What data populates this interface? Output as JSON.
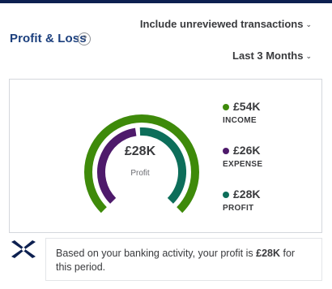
{
  "header": {
    "title": "Profit & Loss",
    "help_glyph": "?",
    "help_icon": "question-circle-icon"
  },
  "filters": {
    "review_label": "Include unreviewed transactions",
    "period_label": "Last 3 Months",
    "chevron": "⌄"
  },
  "summary": {
    "profit_value": "£28K",
    "profit_caption": "Profit"
  },
  "chart_data": {
    "type": "pie",
    "subtype": "gauge-donut",
    "currency": "GBP",
    "rings": [
      {
        "name": "INCOME",
        "value": 54,
        "unit": "K",
        "color": "#3e8a0a",
        "ring": "outer",
        "fraction_of_gauge": 1.0
      },
      {
        "name": "EXPENSE",
        "value": 26,
        "unit": "K",
        "color": "#4e1a6b",
        "ring": "inner",
        "fraction_of_gauge": 0.48
      },
      {
        "name": "PROFIT",
        "value": 28,
        "unit": "K",
        "color": "#0d6e5a",
        "ring": "inner",
        "fraction_of_gauge": 0.52
      }
    ]
  },
  "legend": [
    {
      "key": "income",
      "value": "£54K",
      "label": "INCOME",
      "color": "#3e8a0a"
    },
    {
      "key": "expense",
      "value": "£26K",
      "label": "EXPENSE",
      "color": "#4e1a6b"
    },
    {
      "key": "profit",
      "value": "£28K",
      "label": "PROFIT",
      "color": "#0d6e5a"
    }
  ],
  "insight": {
    "icon": "bank-logo-icon",
    "text_before": "Based on your banking activity, your profit is ",
    "text_bold": "£28K",
    "text_after": " for this period."
  }
}
